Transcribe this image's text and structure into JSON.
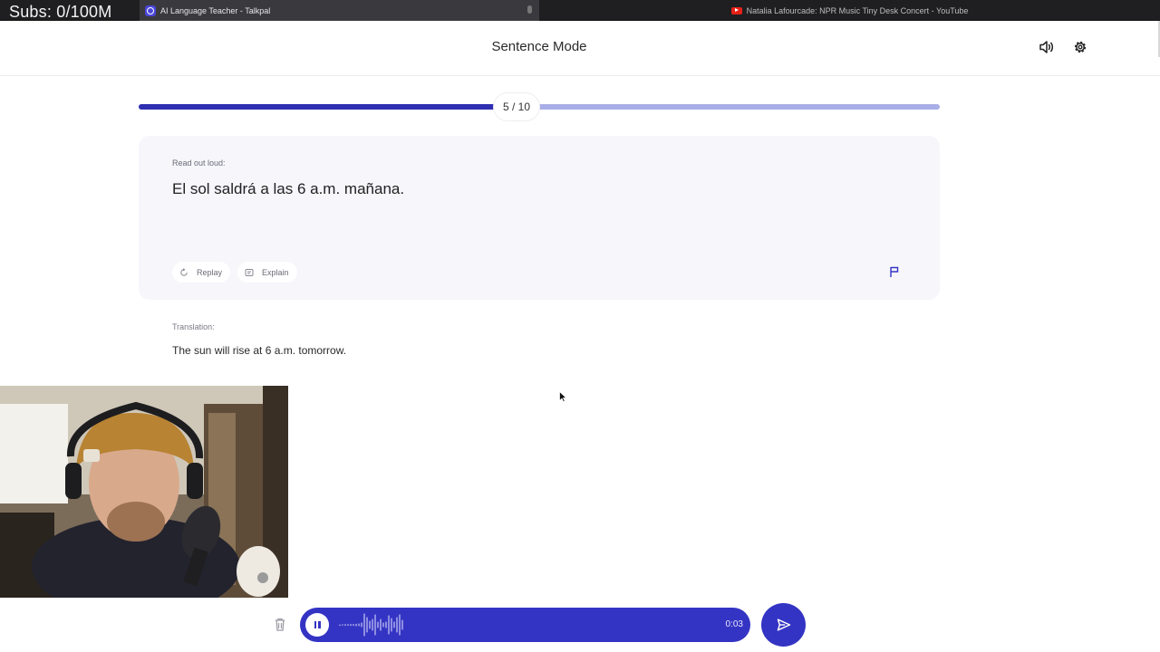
{
  "overlay": {
    "subs_text": "Subs: 0/100M"
  },
  "browser": {
    "tabs": [
      {
        "title": "AI Language Teacher - Talkpal",
        "active": true
      },
      {
        "title": "Natalia Lafourcade: NPR Music Tiny Desk Concert - YouTube",
        "active": false
      }
    ]
  },
  "header": {
    "title": "Sentence Mode",
    "icons": [
      "speaker-icon",
      "gear-icon"
    ]
  },
  "progress": {
    "current": 5,
    "total": 10,
    "label": "5 / 10"
  },
  "card": {
    "label": "Read out loud:",
    "sentence": "El sol saldrá a las 6 a.m. mañana.",
    "replay_label": "Replay",
    "explain_label": "Explain"
  },
  "translation": {
    "label": "Translation:",
    "text": "The sun will rise at 6 a.m. tomorrow."
  },
  "recorder": {
    "time": "0:03",
    "icons": [
      "trash-icon",
      "pause-icon",
      "send-icon"
    ]
  },
  "colors": {
    "accent": "#3434c4",
    "progress_fill": "#2f2fb2",
    "progress_track": "#a9aee6",
    "card_bg": "#f6f6fb"
  }
}
